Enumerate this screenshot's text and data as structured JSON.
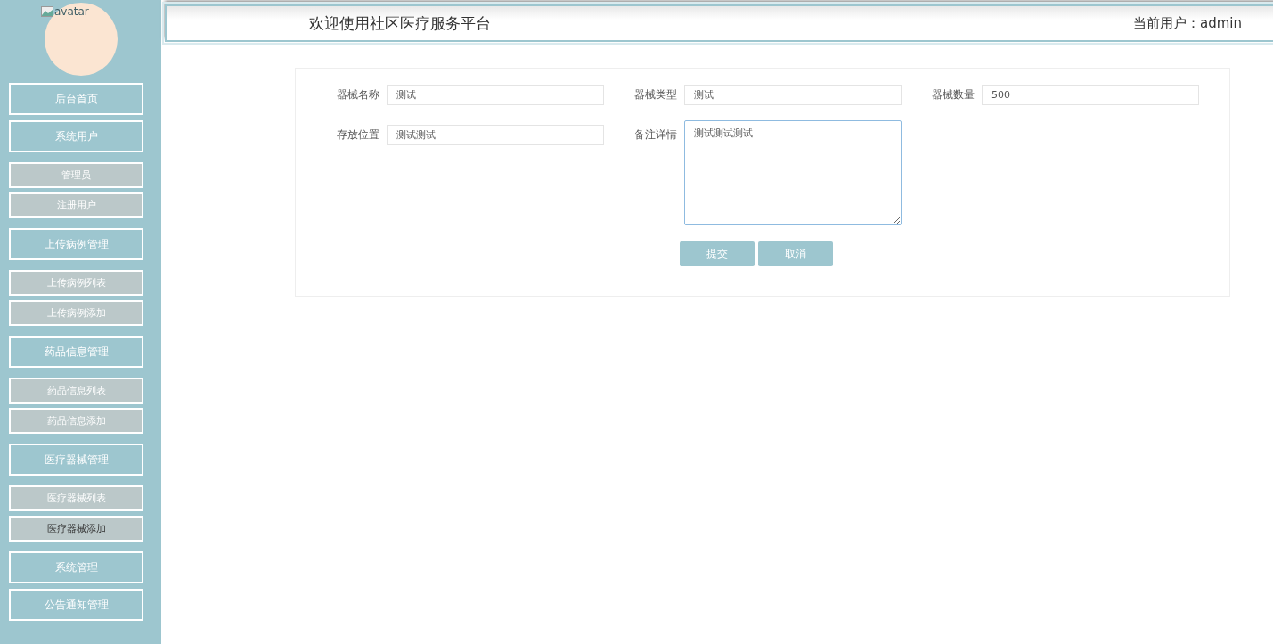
{
  "sidebar": {
    "avatar": {
      "alt": "avatar"
    },
    "items": [
      {
        "label": "后台首页",
        "kind": "group",
        "selected": false
      },
      {
        "label": "系统用户",
        "kind": "group",
        "selected": false
      },
      {
        "label": "管理员",
        "kind": "link",
        "selected": false
      },
      {
        "label": "注册用户",
        "kind": "link",
        "selected": false
      },
      {
        "label": "上传病例管理",
        "kind": "group",
        "selected": false
      },
      {
        "label": "上传病例列表",
        "kind": "link",
        "selected": false
      },
      {
        "label": "上传病例添加",
        "kind": "link",
        "selected": false
      },
      {
        "label": "药品信息管理",
        "kind": "group",
        "selected": false
      },
      {
        "label": "药品信息列表",
        "kind": "link",
        "selected": false
      },
      {
        "label": "药品信息添加",
        "kind": "link",
        "selected": false
      },
      {
        "label": "医疗器械管理",
        "kind": "group",
        "selected": false
      },
      {
        "label": "医疗器械列表",
        "kind": "link",
        "selected": false
      },
      {
        "label": "医疗器械添加",
        "kind": "link",
        "selected": true
      },
      {
        "label": "系统管理",
        "kind": "group",
        "selected": false
      },
      {
        "label": "公告通知管理",
        "kind": "group",
        "selected": false
      }
    ]
  },
  "header": {
    "title": "欢迎使用社区医疗服务平台",
    "user": "当前用户：admin"
  },
  "form": {
    "fields": [
      {
        "label": "器械名称",
        "kind": "input",
        "value": "测试"
      },
      {
        "label": "器械类型",
        "kind": "input",
        "value": "测试"
      },
      {
        "label": "器械数量",
        "kind": "input",
        "value": "500"
      },
      {
        "label": "存放位置",
        "kind": "input",
        "value": "测试测试"
      },
      {
        "label": "备注详情",
        "kind": "textarea",
        "value": "测试测试测试"
      }
    ],
    "buttons": [
      "提交",
      "取消"
    ]
  }
}
